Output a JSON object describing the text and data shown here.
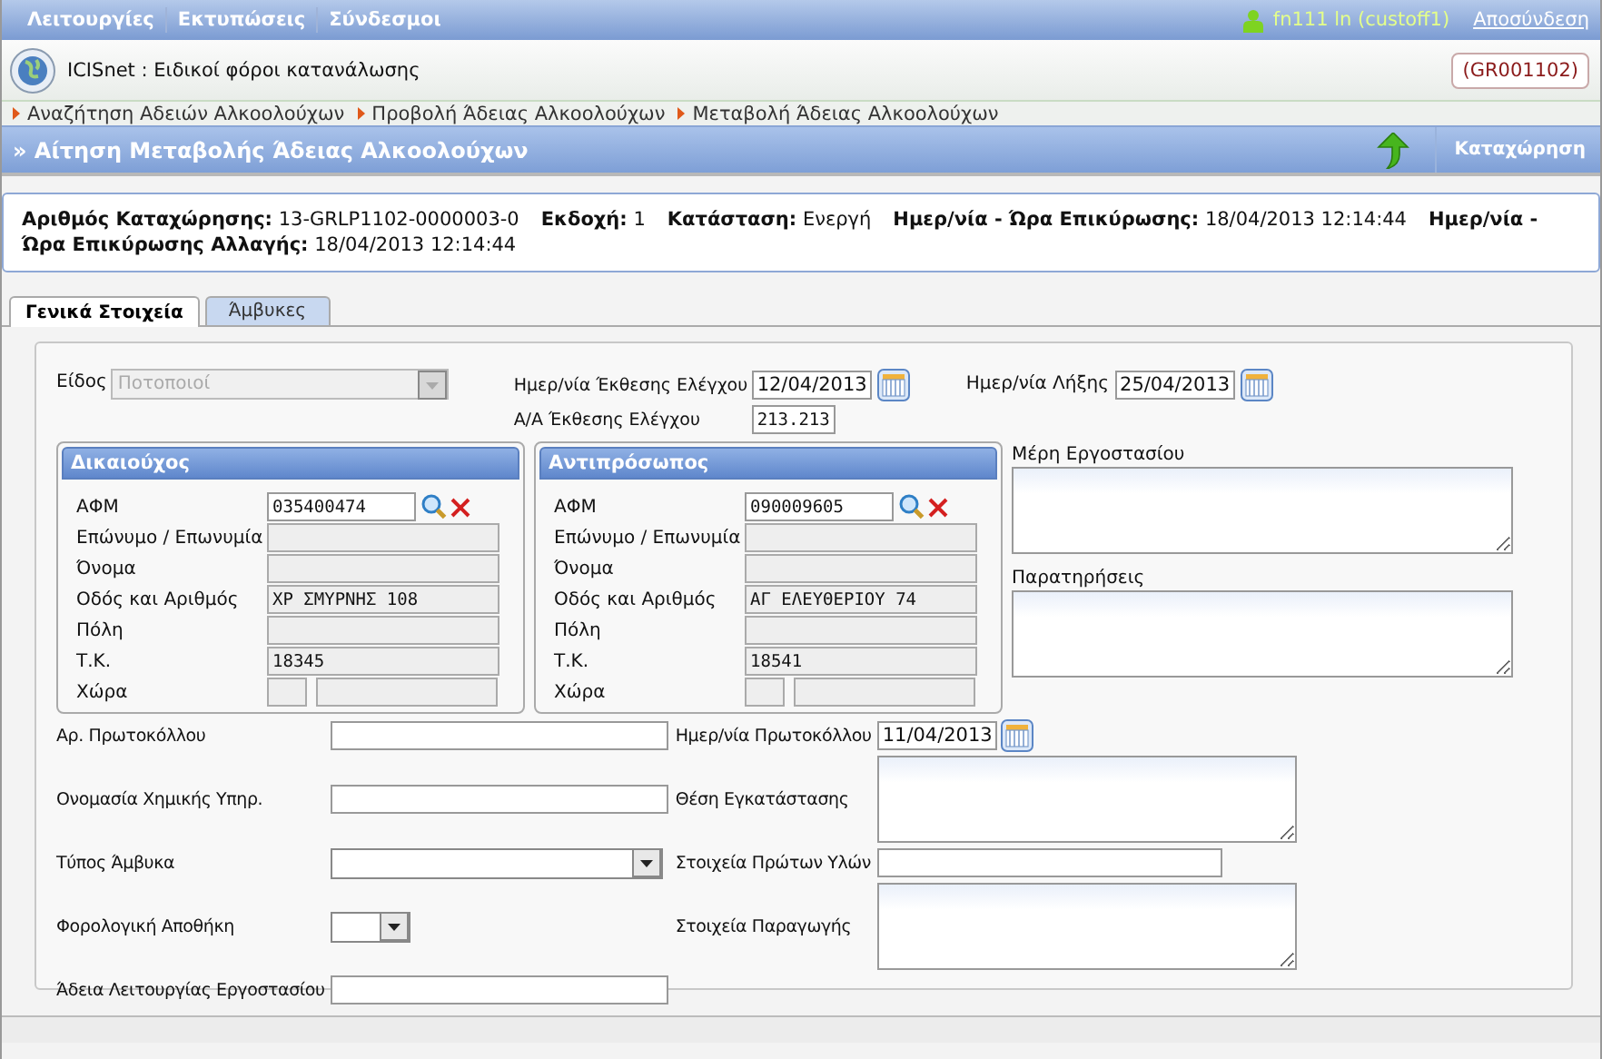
{
  "menu": [
    {
      "label": "Λειτουργίες"
    },
    {
      "label": "Εκτυπώσεις"
    },
    {
      "label": "Σύνδεσμοι"
    }
  ],
  "user": "fn111 ln (custoff1)",
  "logout": "Αποσύνδεση",
  "app_title": "ICISnet : Ειδικοί φόροι κατανάλωσης",
  "office_code": "(GR001102)",
  "breadcrumb": [
    "Αναζήτηση Αδειών Αλκοολούχων",
    "Προβολή Άδειας Αλκοολούχων",
    "Μεταβολή Άδειας Αλκοολούχων"
  ],
  "page_title": "» Αίτηση Μεταβολής Άδειας Αλκοολούχων",
  "save_button": "Καταχώρηση",
  "info": [
    {
      "label": "Αριθμός Καταχώρησης:",
      "value": "13-GRLP1102-0000003-0"
    },
    {
      "label": "Εκδοχή:",
      "value": "1"
    },
    {
      "label": "Κατάσταση:",
      "value": "Ενεργή"
    },
    {
      "label": "Ημερ/νία - Ώρα Επικύρωσης:",
      "value": "18/04/2013 12:14:44"
    },
    {
      "label": "Ημερ/νία - Ώρα Επικύρωσης Αλλαγής:",
      "value": "18/04/2013 12:14:44"
    }
  ],
  "tabs": [
    {
      "label": "Γενικά Στοιχεία",
      "selected": true
    },
    {
      "label": "Άμβυκες",
      "selected": false
    }
  ],
  "form": {
    "kind_select": {
      "label": "Είδος",
      "value": "Ποτοποιοί",
      "disabled": true
    },
    "inspection_date": {
      "label": "Ημερ/νία Έκθεσης Ελέγχου",
      "value": "12/04/2013"
    },
    "expiry_date": {
      "label": "Ημερ/νία Λήξης",
      "value": "25/04/2013"
    },
    "inspection_number": {
      "label": "Α/Α Έκθεσης Ελέγχου",
      "value": "213.213"
    },
    "parties": [
      {
        "title": "Δικαιούχος",
        "fields": [
          {
            "label": "ΑΦΜ",
            "kind": "search",
            "value": "035400474"
          },
          {
            "label": "Επώνυμο / Επωνυμία",
            "kind": "readonly"
          },
          {
            "label": "Όνομα",
            "kind": "readonly"
          },
          {
            "label": "Οδός και Αριθμός",
            "kind": "readonly",
            "value": "ΧΡ ΣΜΥΡΝΗΣ 108"
          },
          {
            "label": "Πόλη",
            "kind": "readonly"
          },
          {
            "label": "Τ.Κ.",
            "kind": "readonly",
            "value": "18345"
          },
          {
            "label": "Χώρα",
            "kind": "country"
          }
        ]
      },
      {
        "title": "Αντιπρόσωπος",
        "fields": [
          {
            "label": "ΑΦΜ",
            "kind": "search",
            "value": "090009605"
          },
          {
            "label": "Επώνυμο / Επωνυμία",
            "kind": "readonly"
          },
          {
            "label": "Όνομα",
            "kind": "readonly"
          },
          {
            "label": "Οδός και Αριθμός",
            "kind": "readonly",
            "value": "ΑΓ ΕΛΕΥΘΕΡΙΟΥ 74"
          },
          {
            "label": "Πόλη",
            "kind": "readonly"
          },
          {
            "label": "Τ.Κ.",
            "kind": "readonly",
            "value": "18541"
          },
          {
            "label": "Χώρα",
            "kind": "country"
          }
        ]
      }
    ],
    "factory_parts": {
      "label": "Μέρη Εργοστασίου"
    },
    "notes": {
      "label": "Παρατηρήσεις"
    },
    "bottom_fields": [
      {
        "label": "Αρ. Πρωτοκόλλου",
        "kind": "text"
      },
      {
        "label": "Ημερ/νία Πρωτοκόλλου",
        "kind": "date",
        "value": "11/04/2013"
      },
      {
        "label": "Ονομασία Χημικής Υπηρ.",
        "kind": "text"
      },
      {
        "label": "Θέση Εγκατάστασης",
        "kind": "textarea"
      },
      {
        "label": "Τύπος Άμβυκα",
        "kind": "select"
      },
      {
        "label": "Στοιχεία Πρώτων Υλών",
        "kind": "wide_text"
      },
      {
        "label": "Φορολογική Αποθήκη",
        "kind": "select_small"
      },
      {
        "label": "Στοιχεία Παραγωγής",
        "kind": "textarea"
      },
      {
        "label": "Άδεια Λειτουργίας Εργοστασίου",
        "kind": "text"
      }
    ]
  }
}
